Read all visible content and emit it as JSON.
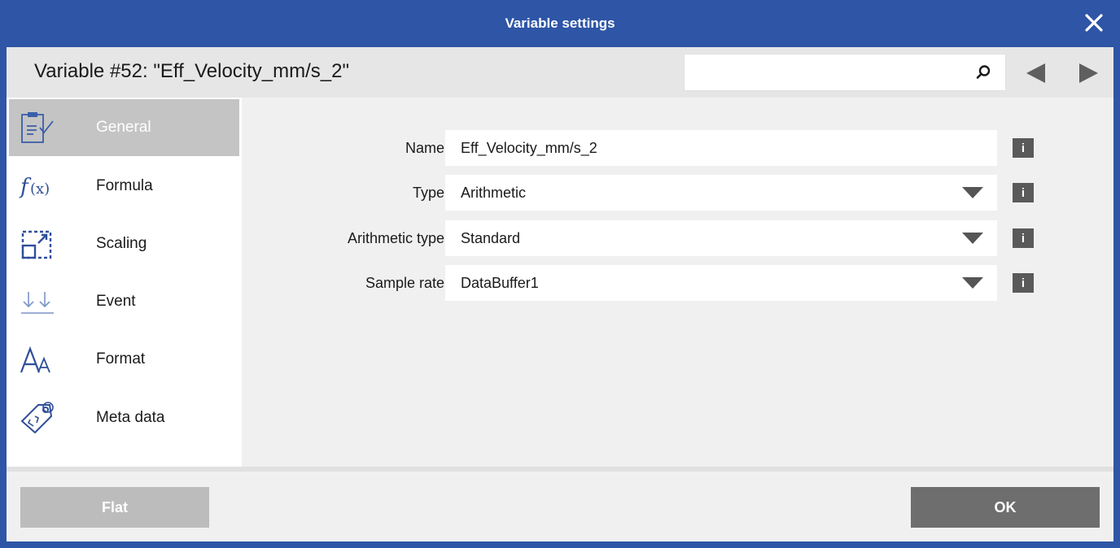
{
  "window": {
    "title": "Variable settings",
    "accent_color": "#2e55a6"
  },
  "header": {
    "variable_title": "Variable #52: \"Eff_Velocity_mm/s_2\"",
    "search": {
      "value": "",
      "placeholder": ""
    }
  },
  "sidebar": {
    "items": [
      {
        "label": "General",
        "icon": "general-icon",
        "active": true
      },
      {
        "label": "Formula",
        "icon": "formula-icon",
        "active": false
      },
      {
        "label": "Scaling",
        "icon": "scaling-icon",
        "active": false
      },
      {
        "label": "Event",
        "icon": "event-icon",
        "active": false
      },
      {
        "label": "Format",
        "icon": "format-icon",
        "active": false
      },
      {
        "label": "Meta data",
        "icon": "meta-data-icon",
        "active": false
      }
    ]
  },
  "general": {
    "name": {
      "label": "Name",
      "value": "Eff_Velocity_mm/s_2"
    },
    "type": {
      "label": "Type",
      "value": "Arithmetic"
    },
    "arithmetic_type": {
      "label": "Arithmetic type",
      "value": "Standard"
    },
    "sample_rate": {
      "label": "Sample rate",
      "value": "DataBuffer1"
    },
    "info_glyph": "i"
  },
  "footer": {
    "flat_label": "Flat",
    "ok_label": "OK"
  }
}
